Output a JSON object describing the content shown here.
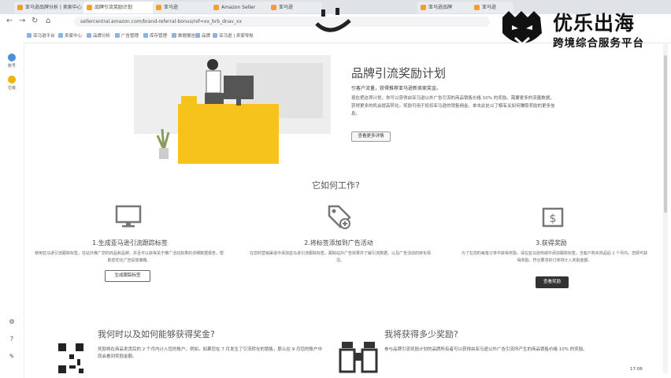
{
  "browser": {
    "tabs": [
      {
        "label": "亚马逊品牌分析 | 卖家中心"
      },
      {
        "label": "品牌引流奖励计划"
      },
      {
        "label": "亚马逊"
      },
      {
        "label": "Amazon Seller"
      },
      {
        "label": "亚马逊"
      },
      {
        "label": "亚马逊品牌"
      },
      {
        "label": "亚马逊"
      }
    ],
    "url": "sellercentral.amazon.com/brand-referral-bonus/ref=xx_brb_dnav_xx",
    "bookmarks": [
      "亚马逊平台",
      "卖家中心",
      "品牌分析",
      "广告管理",
      "库存管理",
      "数据报告",
      "品牌",
      "亚马逊 | 卖家导航"
    ]
  },
  "sidebar": {
    "items": [
      {
        "label": "账号"
      },
      {
        "label": "亿级"
      }
    ]
  },
  "logo": {
    "title": "优乐出海",
    "subtitle": "跨境综合服务平台"
  },
  "hero": {
    "title": "品牌引流奖励计划",
    "subtitle": "引客户流量，获得推荐亚马逊新卖家奖金。",
    "paragraph": "现在把这项计划，你可以获得由亚马逊以外广告引流的商品销售价格 10% 的奖励。需要更多的流量数据，获得更多的机会提高转化。奖励可用于抵扣亚马逊的销售佣金。单击此处以了解有关如何赚取奖励的更多信息。",
    "button": "查看更多详情"
  },
  "how": {
    "title": "它如何工作?",
    "steps": [
      {
        "title": "1.生成亚马逊引流跟踪标签",
        "desc": "使用亚马逊引流跟踪标签，在站外推广您的商品和品牌。并且可以获得关于推广活动效果的详细数据报告，帮助您优化广告投放策略。",
        "button": "生成跟踪标签"
      },
      {
        "title": "2.将标签添加到广告活动",
        "desc": "在您的营销渠道中添加亚马逊引流跟踪标签，跟踪站外广告效果并了解引流数据。以及广告活动的转化情况。",
        "button": ""
      },
      {
        "title": "3.获得奖励",
        "desc": "为了在您的每笔订单中获得奖励，请在亚马逊商城中添加跟踪标签，当客户购买商品后 2 个月内，您即可获得奖励。符合要求的订单将计入奖励金额。",
        "button": "查看奖励"
      }
    ]
  },
  "when": {
    "title": "我何时以及如何能够获得奖金?",
    "paragraph": "奖励将在商品发货后的 2 个月内计入您的账户。例如，如果您在 7 月发生了引流转化的销售，那么在 9 月您的账户中就会看到奖励金额。"
  },
  "howmuch": {
    "title": "我将获得多少奖励?",
    "paragraph": "参与品牌引流奖励计划的品牌所有者可以获得由亚马逊以外广告引流所产生的商品销售价格 10% 的奖励。"
  },
  "taskbar": {
    "time": "17:06"
  }
}
